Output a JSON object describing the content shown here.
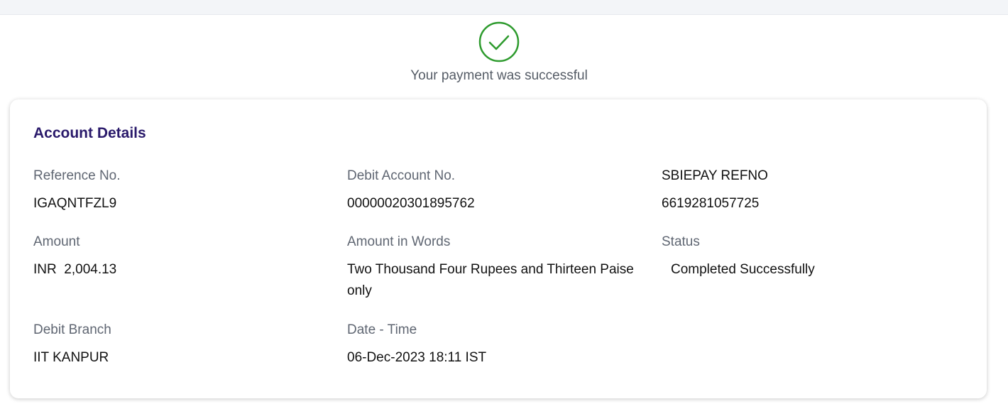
{
  "header": {
    "success_message": "Your payment was successful"
  },
  "icons": {
    "success": "check-circle-icon"
  },
  "colors": {
    "success_green": "#2e9b2e",
    "title_purple": "#2a1a6b",
    "label_gray": "#5f6672"
  },
  "account": {
    "title": "Account Details",
    "reference_label": "Reference No.",
    "reference_value": "IGAQNTFZL9",
    "debit_account_label": "Debit Account No.",
    "debit_account_value": "00000020301895762",
    "sbiepay_label": "SBIEPAY REFNO",
    "sbiepay_value": "6619281057725",
    "amount_label": "Amount",
    "amount_value": "INR  2,004.13",
    "amount_words_label": "Amount in Words",
    "amount_words_value": "Two Thousand Four Rupees and Thirteen Paise only",
    "status_label": "Status",
    "status_value": "Completed Successfully",
    "branch_label": "Debit Branch",
    "branch_value": "IIT KANPUR",
    "datetime_label": "Date - Time",
    "datetime_value": "06-Dec-2023 18:11 IST"
  }
}
